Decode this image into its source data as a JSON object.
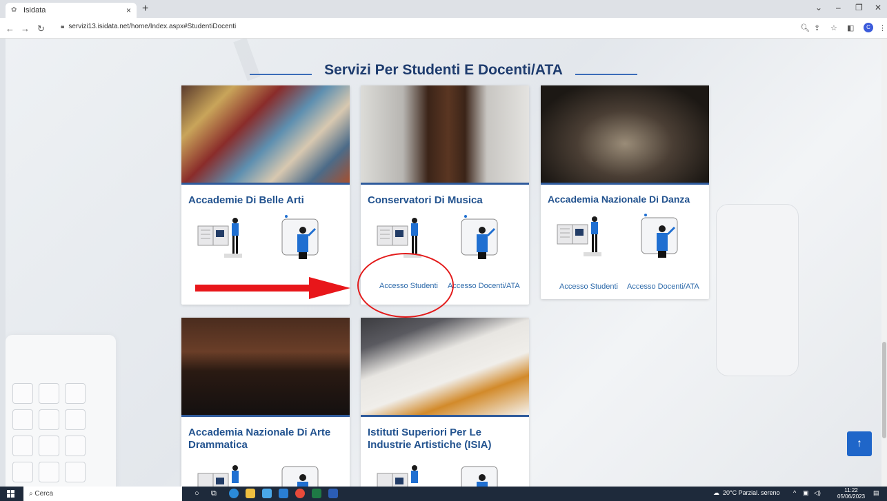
{
  "browser": {
    "tab_title": "Isidata",
    "tab_close": "×",
    "new_tab": "+",
    "url": "servizi13.isidata.net/home/Index.aspx#StudentiDocenti"
  },
  "page": {
    "heading": "Servizi Per Studenti E Docenti/ATA",
    "cards": [
      {
        "title": "Accademie Di Belle Arti",
        "link_students": "",
        "link_staff": ""
      },
      {
        "title": "Conservatori Di Musica",
        "link_students": "Accesso Studenti",
        "link_staff": "Accesso Docenti/ATA"
      },
      {
        "title": "Accademia Nazionale Di Danza",
        "link_students": "Accesso Studenti",
        "link_staff": "Accesso Docenti/ATA"
      },
      {
        "title": "Accademia Nazionale Di Arte Drammatica"
      },
      {
        "title": "Istituti Superiori Per Le Industrie Artistiche (ISIA)"
      }
    ],
    "scroll_top": "↑"
  },
  "taskbar": {
    "search_placeholder": "Cerca",
    "weather": "20°C Parzial. sereno",
    "time": "11:22",
    "date": "05/06/2023"
  },
  "colors": {
    "accent": "#23538f",
    "annotation_red": "#e8161a",
    "scroll_button": "#1f66c9"
  }
}
